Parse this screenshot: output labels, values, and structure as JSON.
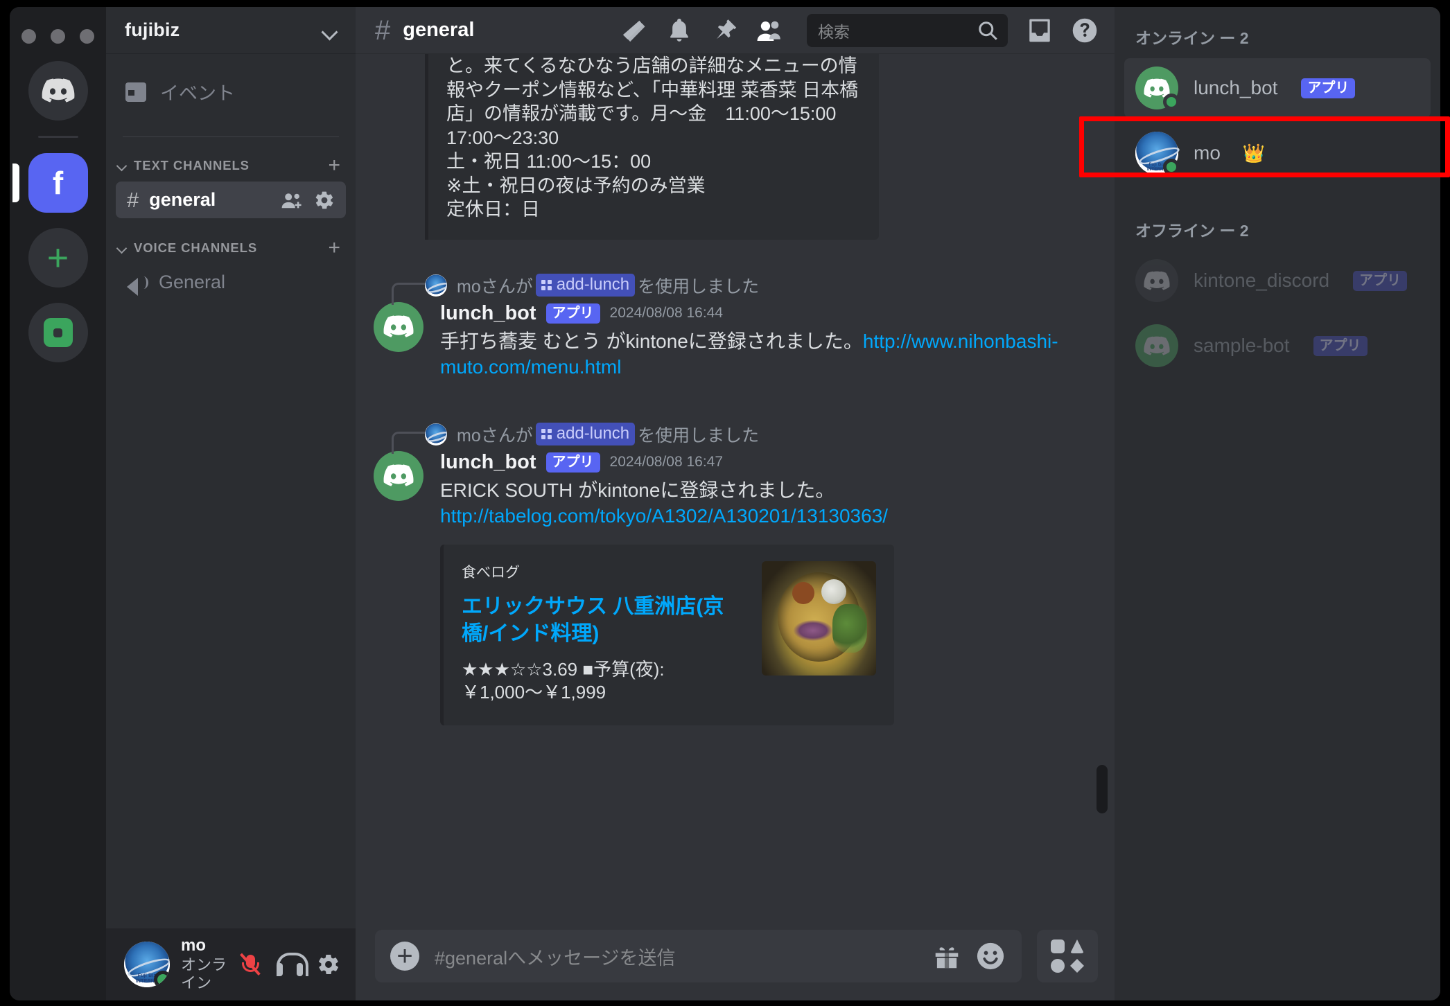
{
  "window": {
    "traffic_dots": 3
  },
  "rail": {
    "items": [
      {
        "name": "discord-home",
        "label": ""
      },
      {
        "name": "server-fujibiz",
        "label": "f",
        "active": true
      },
      {
        "name": "add-server",
        "label": "+"
      },
      {
        "name": "server-kintone",
        "label": ""
      }
    ]
  },
  "sidebar": {
    "guild_name": "fujibiz",
    "events_label": "イベント",
    "categories": [
      {
        "name": "TEXT CHANNELS",
        "channels": [
          {
            "name": "general",
            "active": true
          }
        ]
      },
      {
        "name": "VOICE CHANNELS",
        "channels": [
          {
            "name": "General",
            "active": false
          }
        ]
      }
    ],
    "user_panel": {
      "name": "mo",
      "status": "オンライン"
    }
  },
  "header": {
    "channel": "general",
    "search_placeholder": "検索"
  },
  "messages": {
    "partial_embed_text": "と。来てくるなひなう店舗の詳細なメニューの情報やクーポン情報など、「中華料理 菜香菜 日本橋店」の情報が満載です。月〜金　11:00〜15:00 17:00〜23:30\n土・祝日 11:00〜15：00\n※土・祝日の夜は予約のみ営業\n定休日：日",
    "items": [
      {
        "system_prefix": "moさんが",
        "command": "add-lunch",
        "system_suffix": "を使用しました",
        "author": "lunch_bot",
        "app_tag": "アプリ",
        "timestamp": "2024/08/08 16:44",
        "text_before_link": "手打ち蕎麦 むとう がkintoneに登録されました。",
        "link": "http://www.nihonbashi-muto.com/menu.html",
        "embed": null
      },
      {
        "system_prefix": "moさんが",
        "command": "add-lunch",
        "system_suffix": "を使用しました",
        "author": "lunch_bot",
        "app_tag": "アプリ",
        "timestamp": "2024/08/08 16:47",
        "text_before_link": "ERICK SOUTH がkintoneに登録されました。",
        "link": "http://tabelog.com/tokyo/A1302/A130201/13130363/",
        "embed": {
          "provider": "食べログ",
          "title": "エリックサウス 八重洲店(京橋/インド料理)",
          "description": "★★★☆☆3.69 ■予算(夜): ￥1,000〜￥1,999"
        }
      }
    ]
  },
  "composer": {
    "placeholder": "#generalへメッセージを送信"
  },
  "members": {
    "online_header": "オンライン ー 2",
    "offline_header": "オフライン ー 2",
    "online": [
      {
        "name": "lunch_bot",
        "tag": "アプリ",
        "highlighted": true,
        "avatar": "bot-green",
        "crown": false
      },
      {
        "name": "mo",
        "tag": null,
        "highlighted": false,
        "avatar": "globe",
        "crown": true
      }
    ],
    "offline": [
      {
        "name": "kintone_discord",
        "tag": "アプリ",
        "avatar": "bot-grey"
      },
      {
        "name": "sample-bot",
        "tag": "アプリ",
        "avatar": "bot-green"
      }
    ]
  },
  "colors": {
    "accent": "#5865f2",
    "link": "#00a8fc",
    "online": "#3ba55d",
    "highlight_box": "#ff0000",
    "chat_bg": "#313338",
    "sidebar_bg": "#2b2d31",
    "rail_bg": "#1e1f22"
  }
}
